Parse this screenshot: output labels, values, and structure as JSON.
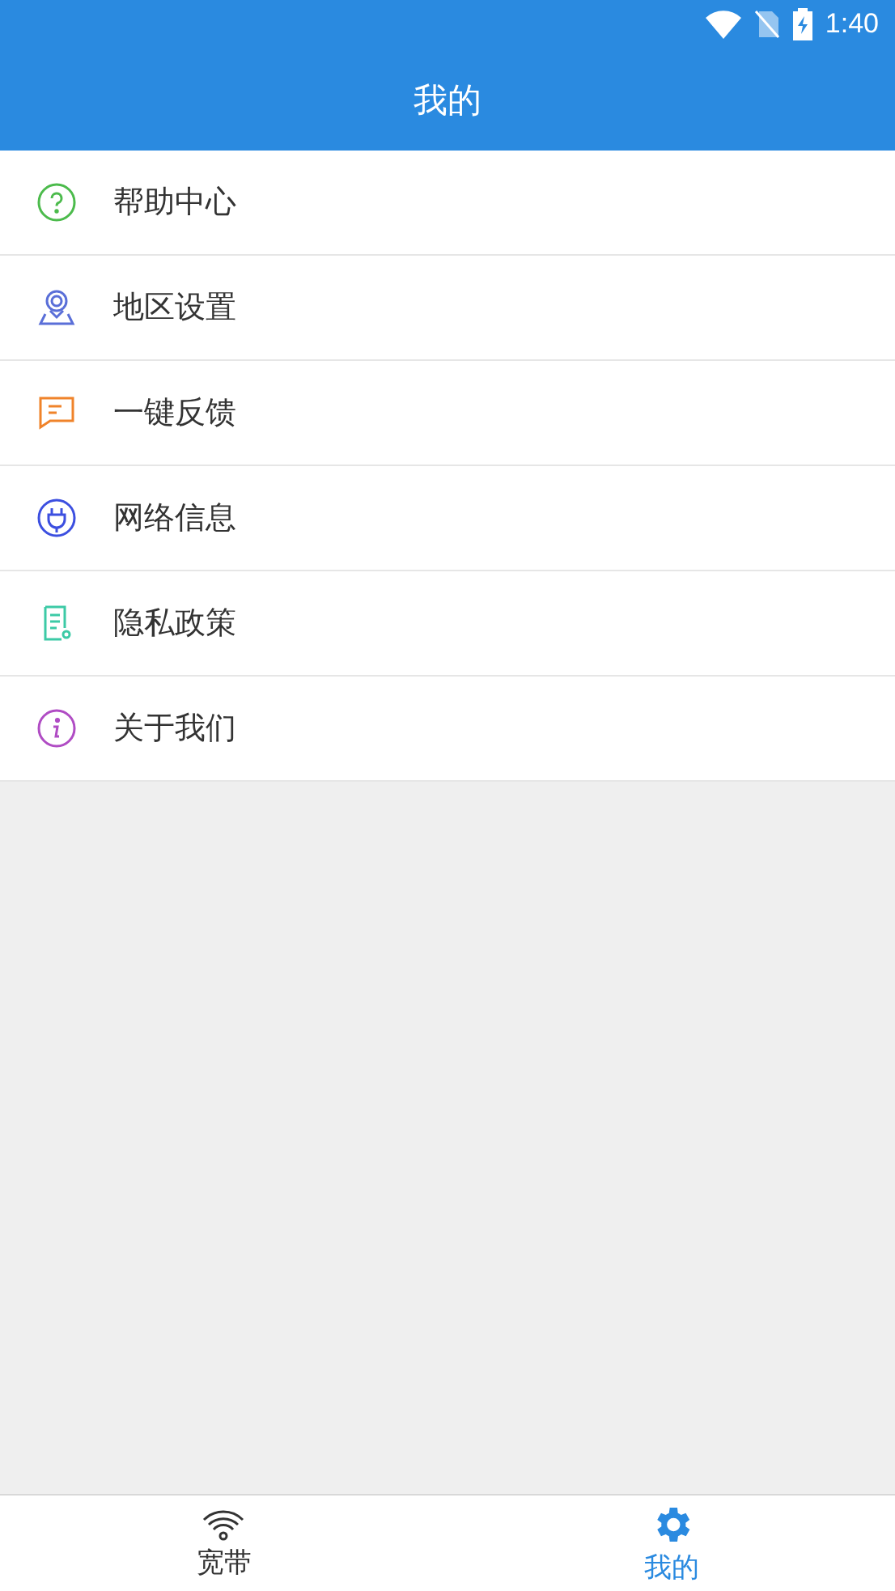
{
  "status_bar": {
    "time": "1:40"
  },
  "header": {
    "title": "我的"
  },
  "menu": [
    {
      "label": "帮助中心",
      "kind": "help",
      "color": "#4cbb4c"
    },
    {
      "label": "地区设置",
      "kind": "location",
      "color": "#5a6fd8"
    },
    {
      "label": "一键反馈",
      "kind": "feedback",
      "color": "#f0832a"
    },
    {
      "label": "网络信息",
      "kind": "network",
      "color": "#3c4fe0"
    },
    {
      "label": "隐私政策",
      "kind": "privacy",
      "color": "#3ccaa6"
    },
    {
      "label": "关于我们",
      "kind": "about",
      "color": "#b04cc4"
    }
  ],
  "bottom_nav": [
    {
      "label": "宽带",
      "kind": "wifi",
      "selected": false
    },
    {
      "label": "我的",
      "kind": "settings",
      "selected": true
    }
  ]
}
